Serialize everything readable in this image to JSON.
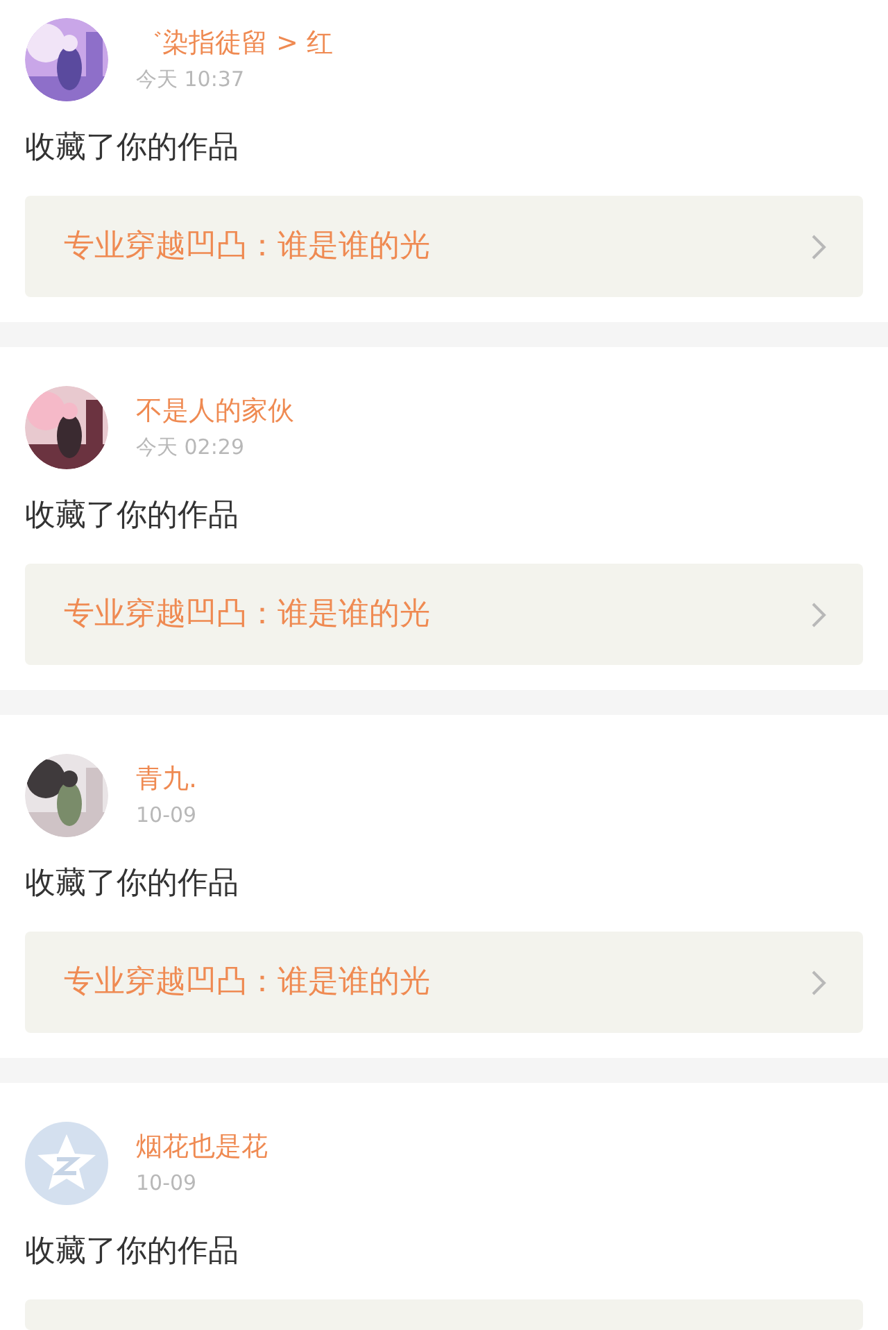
{
  "notifications": [
    {
      "user": "゛染指徒留 > 红",
      "time": "今天 10:37",
      "action": "收藏了你的作品",
      "work_title": "专业穿越凹凸：谁是谁的光"
    },
    {
      "user": "不是人的家伙",
      "time": "今天 02:29",
      "action": "收藏了你的作品",
      "work_title": "专业穿越凹凸：谁是谁的光"
    },
    {
      "user": "青九.",
      "time": "10-09",
      "action": "收藏了你的作品",
      "work_title": "专业穿越凹凸：谁是谁的光"
    },
    {
      "avatar": {
        "kind": "default"
      },
      "user": "烟花也是花",
      "time": "10-09",
      "action": "收藏了你的作品"
    }
  ]
}
